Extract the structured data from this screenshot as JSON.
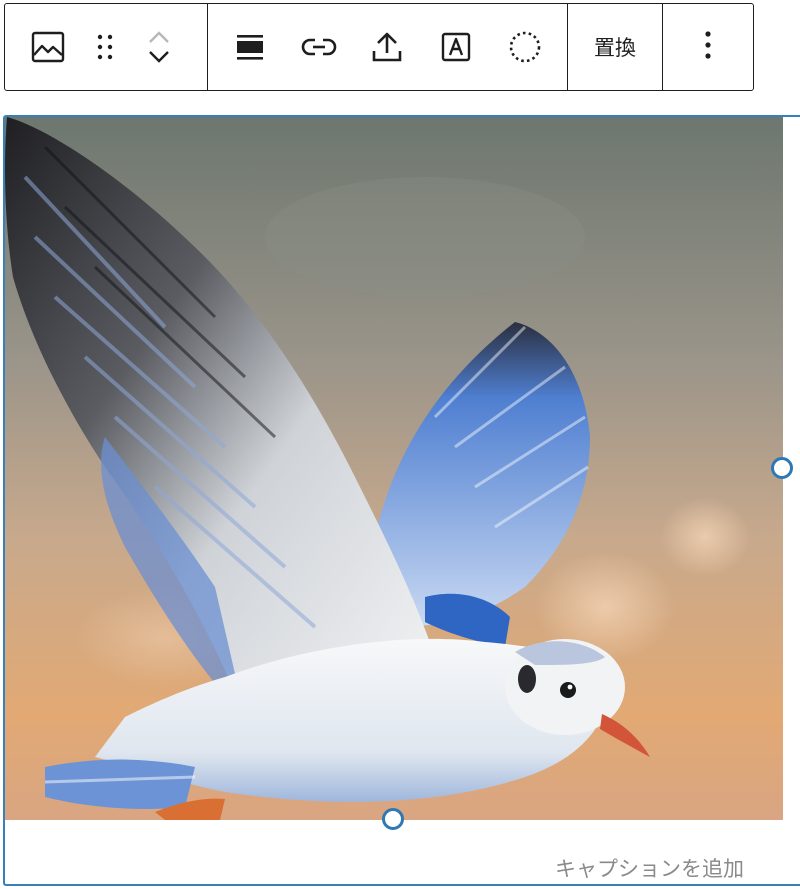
{
  "toolbar": {
    "groups": [
      {
        "name": "block-controls",
        "items": [
          {
            "icon": "image-icon"
          },
          {
            "icon": "drag-handle-icon"
          },
          {
            "icon": "move-up-icon"
          },
          {
            "icon": "move-down-icon"
          }
        ]
      },
      {
        "name": "image-tools",
        "items": [
          {
            "icon": "align-icon"
          },
          {
            "icon": "link-icon"
          },
          {
            "icon": "upload-icon"
          },
          {
            "icon": "text-overlay-icon"
          },
          {
            "icon": "crop-circle-icon"
          }
        ]
      }
    ],
    "replace_label": "置換",
    "more_icon": "more-options-icon"
  },
  "image_block": {
    "image": {
      "subject": "seagull-in-flight",
      "colors": {
        "sky_top": "#6d776f",
        "sky_mid": "#a79a86",
        "sky_bottom": "#e2a974",
        "wing_blue": "#5b8fd9",
        "body_white": "#f4f5f6",
        "feather_dark": "#2a2a2a",
        "beak": "#d2553a"
      }
    },
    "resize_handles": [
      "right",
      "bottom"
    ],
    "caption_placeholder": "キャプションを追加",
    "selection_color": "#3a80b8"
  }
}
